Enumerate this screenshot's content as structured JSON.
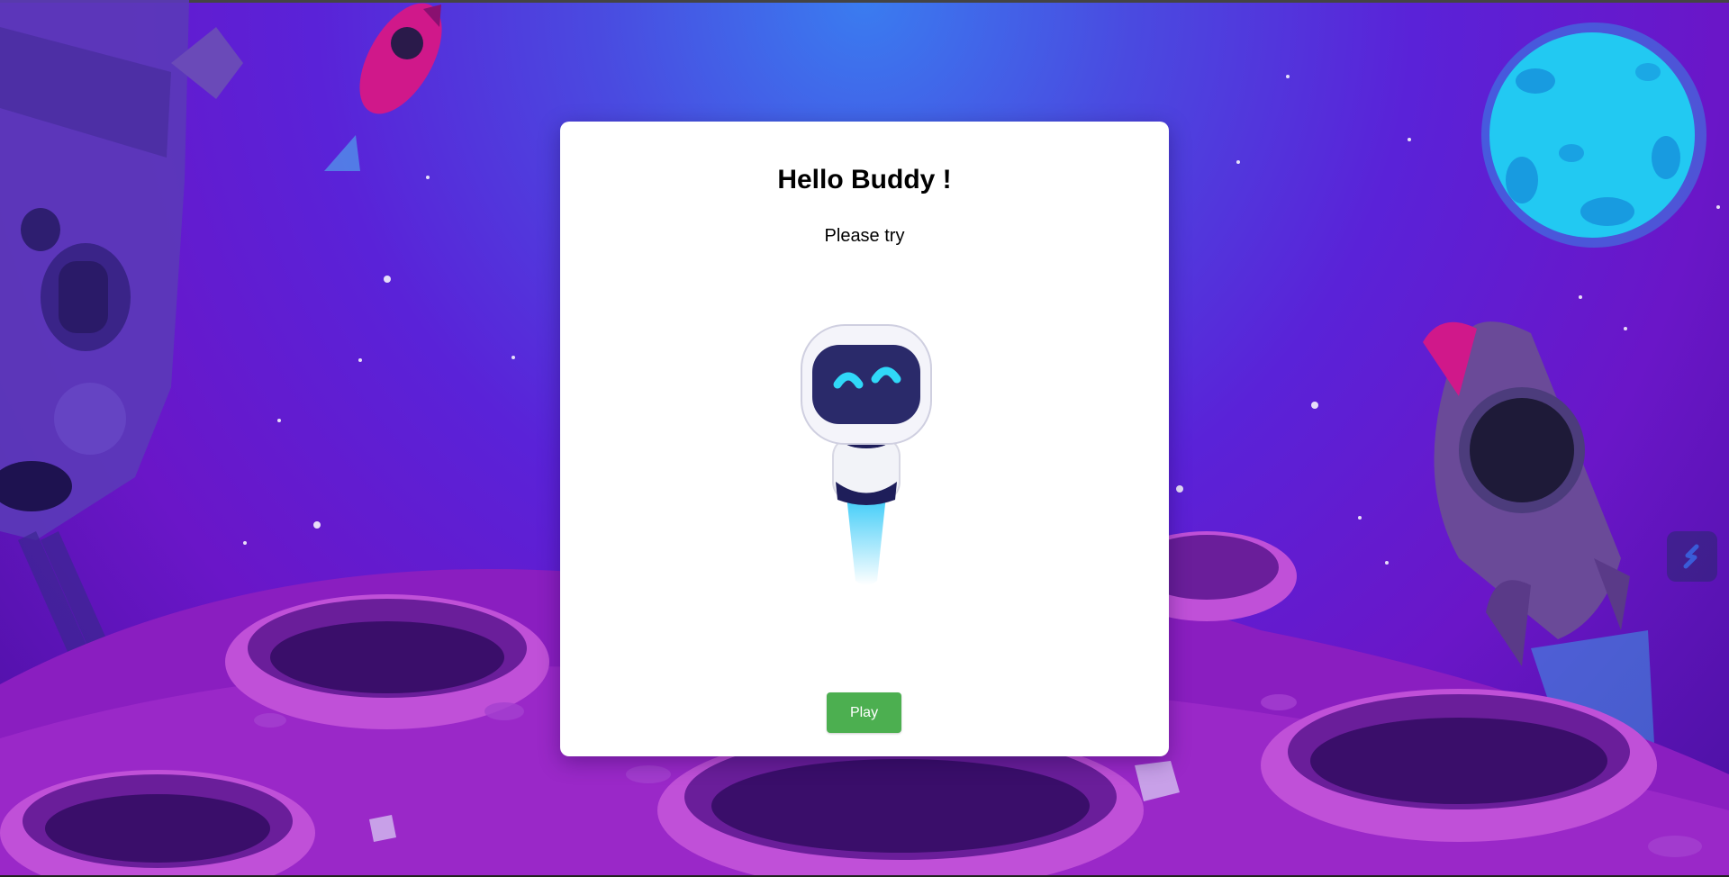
{
  "modal": {
    "title": "Hello Buddy !",
    "subtitle": "Please try",
    "play_label": "Play"
  },
  "colors": {
    "play_button": "#4caf50",
    "modal_background": "#ffffff",
    "sky_top": "#3a7cf0",
    "sky_bottom": "#6a16c8"
  },
  "icons": {
    "side_widget": "slash-icon",
    "mascot": "robot-icon"
  }
}
